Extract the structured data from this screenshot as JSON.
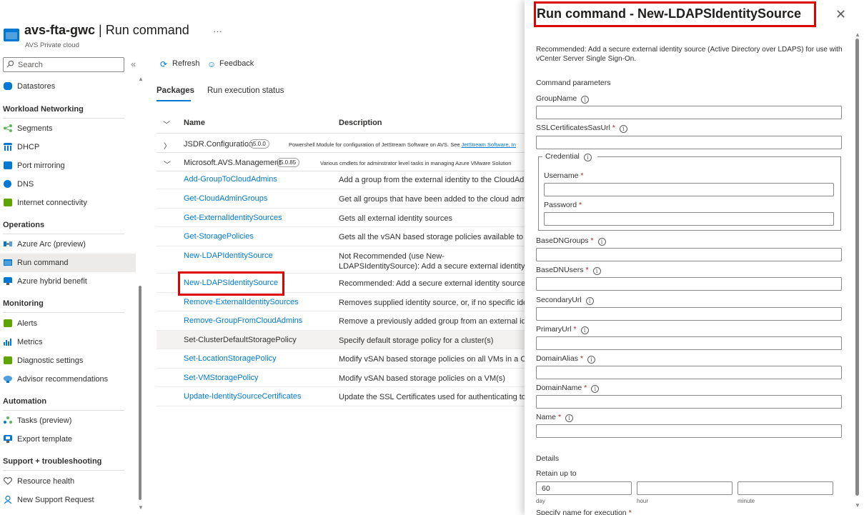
{
  "header": {
    "title": "avs-fta-gwc",
    "separator": " | ",
    "page": "Run command",
    "more": "···",
    "subtitle": "AVS Private cloud"
  },
  "sidebar": {
    "search_placeholder": "Search",
    "collapse_icon": "«",
    "items": [
      {
        "label": "Datastores",
        "icon": "datastore-icon",
        "color": "#0078d4"
      },
      {
        "label": "Segments",
        "icon": "segments-icon",
        "color": "#5cb85c"
      },
      {
        "label": "DHCP",
        "icon": "dhcp-icon",
        "color": "#0078d4"
      },
      {
        "label": "Port mirroring",
        "icon": "port-mirroring-icon",
        "color": "#0078d4"
      },
      {
        "label": "DNS",
        "icon": "dns-icon",
        "color": "#0078d4"
      },
      {
        "label": "Internet connectivity",
        "icon": "internet-icon",
        "color": "#5ea500"
      },
      {
        "label": "Azure Arc (preview)",
        "icon": "arc-icon",
        "color": "#0078d4"
      },
      {
        "label": "Run command",
        "icon": "run-command-icon",
        "color": "#0078d4"
      },
      {
        "label": "Azure hybrid benefit",
        "icon": "hybrid-benefit-icon",
        "color": "#0078d4"
      },
      {
        "label": "Alerts",
        "icon": "alerts-icon",
        "color": "#5ea500"
      },
      {
        "label": "Metrics",
        "icon": "metrics-icon",
        "color": "#0078d4"
      },
      {
        "label": "Diagnostic settings",
        "icon": "diagnostic-icon",
        "color": "#5ea500"
      },
      {
        "label": "Advisor recommendations",
        "icon": "advisor-icon",
        "color": "#0078d4"
      },
      {
        "label": "Tasks (preview)",
        "icon": "tasks-icon",
        "color": "#5cb85c"
      },
      {
        "label": "Export template",
        "icon": "export-icon",
        "color": "#0078d4"
      },
      {
        "label": "Resource health",
        "icon": "heart-icon",
        "color": "#605e5c"
      },
      {
        "label": "New Support Request",
        "icon": "support-icon",
        "color": "#0078d4"
      }
    ],
    "sections": {
      "workload_networking": "Workload Networking",
      "operations": "Operations",
      "monitoring": "Monitoring",
      "automation": "Automation",
      "support": "Support + troubleshooting"
    }
  },
  "toolbar": {
    "refresh": "Refresh",
    "feedback": "Feedback"
  },
  "tabs": {
    "packages": "Packages",
    "run_status": "Run execution status"
  },
  "table": {
    "col_name": "Name",
    "col_description": "Description",
    "packages": [
      {
        "name": "JSDR.Configuration",
        "version": "5.0.0",
        "description": "Powershell Module for configuration of JetStream Software on AVS. See ",
        "link": "JetStream Software, In"
      },
      {
        "name": "Microsoft.AVS.Management",
        "version": "5.0.85",
        "description": "Various cmdlets for adminstrator level tasks in managing Azure VMware Solution"
      }
    ],
    "commands": [
      {
        "name": "Add-GroupToCloudAdmins",
        "description": "Add a group from the external identity to the CloudAdmins"
      },
      {
        "name": "Get-CloudAdminGroups",
        "description": "Get all groups that have been added to the cloud admin"
      },
      {
        "name": "Get-ExternalIdentitySources",
        "description": "Gets all external identity sources"
      },
      {
        "name": "Get-StoragePolicies",
        "description": "Gets all the vSAN based storage policies available to set"
      },
      {
        "name": "New-LDAPIdentitySource",
        "description": "Not Recommended (use New-LDAPSIdentitySource): Add a secure external identity source for use with vCenter Server Single Sign-On."
      },
      {
        "name": "New-LDAPSIdentitySource",
        "description": "Recommended: Add a secure external identity source (Active Directory over LDAPS)"
      },
      {
        "name": "Remove-ExternalIdentitySources",
        "description": "Removes supplied identity source, or, if no specific identity source is provided"
      },
      {
        "name": "Remove-GroupFromCloudAdmins",
        "description": "Remove a previously added group from an external identity"
      },
      {
        "name": "Set-ClusterDefaultStoragePolicy",
        "description": "Specify default storage policy for a cluster(s)"
      },
      {
        "name": "Set-LocationStoragePolicy",
        "description": "Modify vSAN based storage policies on all VMs in a Container"
      },
      {
        "name": "Set-VMStoragePolicy",
        "description": "Modify vSAN based storage policies on a VM(s)"
      },
      {
        "name": "Update-IdentitySourceCertificates",
        "description": "Update the SSL Certificates used for authenticating to an"
      }
    ]
  },
  "panel": {
    "title": "Run command - New-LDAPSIdentitySource",
    "close": "✕",
    "description": "Recommended: Add a secure external identity source (Active Directory over LDAPS) for use with vCenter Server Single Sign-On.",
    "params_heading": "Command parameters",
    "fields": {
      "group_name": "GroupName",
      "ssl_cert": "SSLCertificatesSasUrl",
      "credential": "Credential",
      "username": "Username",
      "password": "Password",
      "base_dn_groups": "BaseDNGroups",
      "base_dn_users": "BaseDNUsers",
      "secondary_url": "SecondaryUrl",
      "primary_url": "PrimaryUrl",
      "domain_alias": "DomainAlias",
      "domain_name": "DomainName",
      "name": "Name"
    },
    "required_mark": "*",
    "info_glyph": "i",
    "details_heading": "Details",
    "retain_label": "Retain up to",
    "retain_day": "60",
    "retain_hour": "",
    "retain_minute": "",
    "unit_day": "day",
    "unit_hour": "hour",
    "unit_minute": "minute",
    "exec_name_label": "Specify name for execution"
  }
}
